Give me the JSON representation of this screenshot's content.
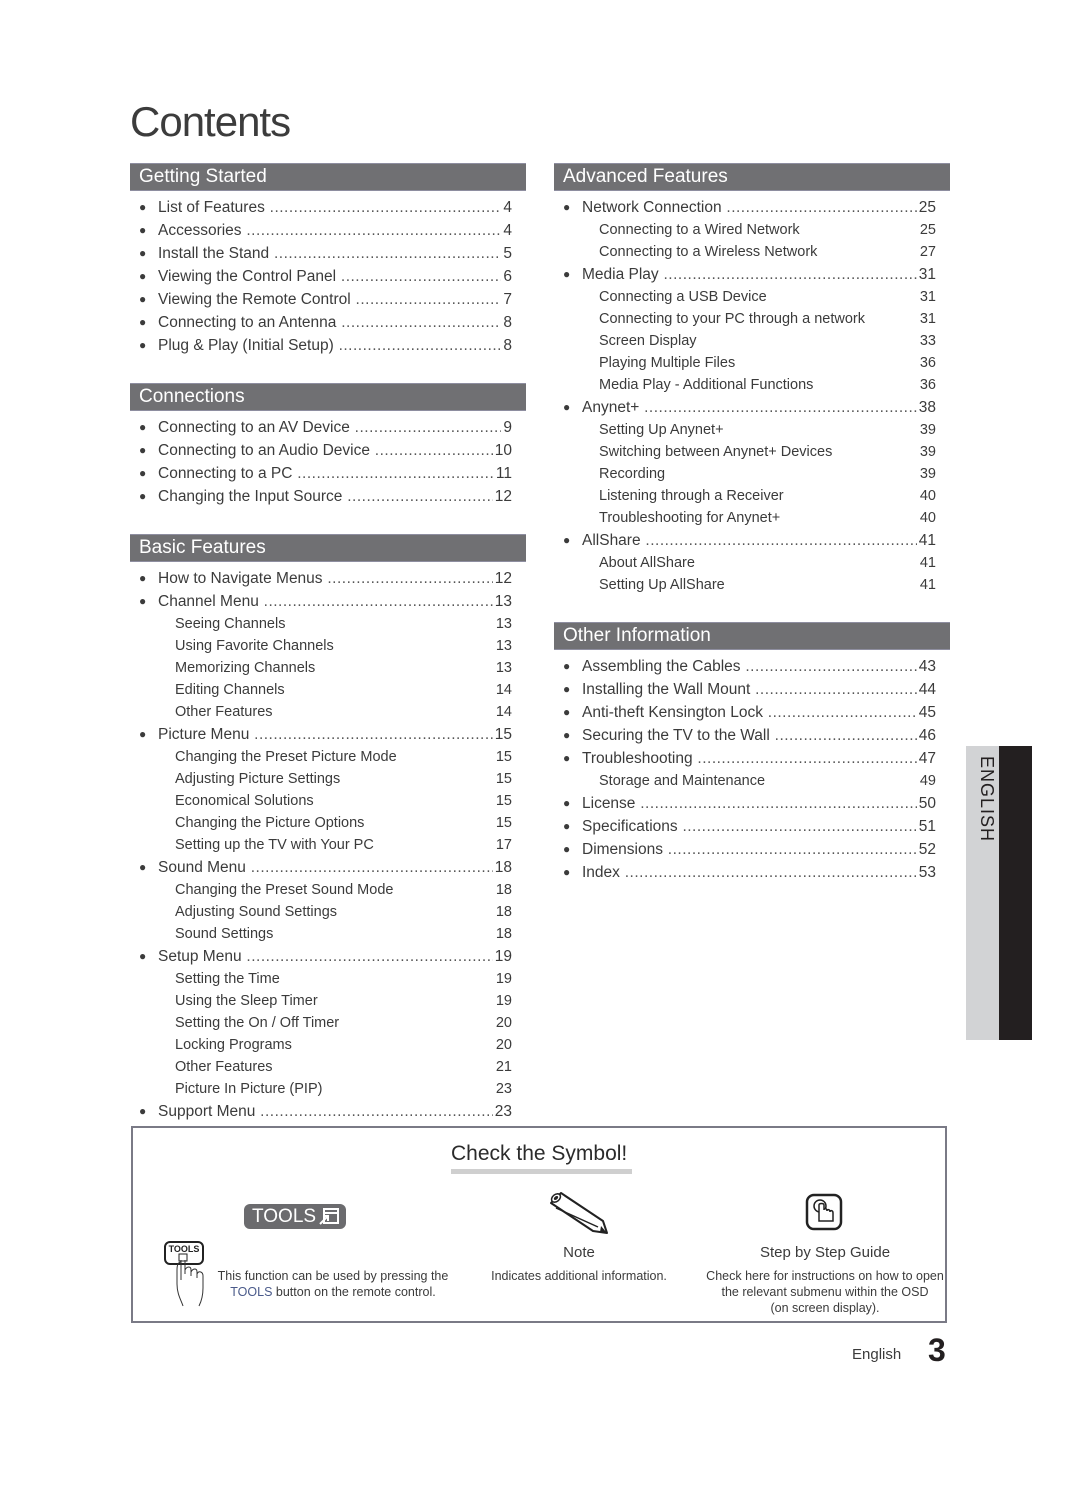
{
  "page_title": "Contents",
  "left_column": [
    {
      "heading": "Getting Started",
      "items": [
        {
          "label": "List of Features",
          "page": "4",
          "level": 1
        },
        {
          "label": "Accessories",
          "page": "4",
          "level": 1
        },
        {
          "label": "Install the Stand",
          "page": "5",
          "level": 1
        },
        {
          "label": "Viewing the Control Panel",
          "page": "6",
          "level": 1
        },
        {
          "label": "Viewing the Remote Control",
          "page": "7",
          "level": 1
        },
        {
          "label": "Connecting to an Antenna",
          "page": "8",
          "level": 1
        },
        {
          "label": "Plug & Play (Initial Setup)",
          "page": "8",
          "level": 1
        }
      ]
    },
    {
      "heading": "Connections",
      "items": [
        {
          "label": "Connecting to an AV Device",
          "page": "9",
          "level": 1
        },
        {
          "label": "Connecting to an Audio Device",
          "page": "10",
          "level": 1
        },
        {
          "label": "Connecting to a PC",
          "page": "11",
          "level": 1
        },
        {
          "label": "Changing the Input Source",
          "page": "12",
          "level": 1
        }
      ]
    },
    {
      "heading": "Basic Features",
      "items": [
        {
          "label": "How to Navigate Menus",
          "page": "12",
          "level": 1
        },
        {
          "label": "Channel Menu",
          "page": "13",
          "level": 1
        },
        {
          "label": "Seeing Channels",
          "page": "13",
          "level": 2
        },
        {
          "label": "Using Favorite Channels",
          "page": "13",
          "level": 2
        },
        {
          "label": "Memorizing Channels",
          "page": "13",
          "level": 2
        },
        {
          "label": "Editing Channels",
          "page": "14",
          "level": 2
        },
        {
          "label": "Other Features",
          "page": "14",
          "level": 2
        },
        {
          "label": "Picture Menu",
          "page": "15",
          "level": 1
        },
        {
          "label": "Changing the Preset Picture Mode",
          "page": "15",
          "level": 2
        },
        {
          "label": "Adjusting Picture Settings",
          "page": "15",
          "level": 2
        },
        {
          "label": "Economical Solutions",
          "page": "15",
          "level": 2
        },
        {
          "label": "Changing the Picture Options",
          "page": "15",
          "level": 2
        },
        {
          "label": "Setting up the TV with Your PC",
          "page": "17",
          "level": 2
        },
        {
          "label": "Sound Menu",
          "page": "18",
          "level": 1
        },
        {
          "label": "Changing the Preset Sound Mode",
          "page": "18",
          "level": 2
        },
        {
          "label": "Adjusting Sound Settings",
          "page": "18",
          "level": 2
        },
        {
          "label": "Sound Settings",
          "page": "18",
          "level": 2
        },
        {
          "label": "Setup Menu",
          "page": "19",
          "level": 1
        },
        {
          "label": "Setting the Time",
          "page": "19",
          "level": 2
        },
        {
          "label": "Using the Sleep Timer",
          "page": "19",
          "level": 2
        },
        {
          "label": "Setting the On / Off Timer",
          "page": "20",
          "level": 2
        },
        {
          "label": "Locking Programs",
          "page": "20",
          "level": 2
        },
        {
          "label": "Other Features",
          "page": "21",
          "level": 2
        },
        {
          "label": "Picture In Picture (PIP)",
          "page": "23",
          "level": 2
        },
        {
          "label": "Support Menu",
          "page": "23",
          "level": 1
        }
      ]
    }
  ],
  "right_column": [
    {
      "heading": "Advanced Features",
      "items": [
        {
          "label": "Network Connection",
          "page": "25",
          "level": 1
        },
        {
          "label": "Connecting to a Wired Network",
          "page": "25",
          "level": 2
        },
        {
          "label": "Connecting to a Wireless Network",
          "page": "27",
          "level": 2
        },
        {
          "label": "Media Play",
          "page": "31",
          "level": 1
        },
        {
          "label": "Connecting a USB Device",
          "page": "31",
          "level": 2
        },
        {
          "label": "Connecting to your PC through a network",
          "page": "31",
          "level": 2
        },
        {
          "label": "Screen Display",
          "page": "33",
          "level": 2
        },
        {
          "label": "Playing Multiple Files",
          "page": "36",
          "level": 2
        },
        {
          "label": "Media Play - Additional Functions",
          "page": "36",
          "level": 2
        },
        {
          "label": "Anynet+",
          "page": "38",
          "level": 1
        },
        {
          "label": "Setting Up Anynet+",
          "page": "39",
          "level": 2
        },
        {
          "label": "Switching between Anynet+ Devices",
          "page": "39",
          "level": 2
        },
        {
          "label": "Recording",
          "page": "39",
          "level": 2
        },
        {
          "label": "Listening through a Receiver",
          "page": "40",
          "level": 2
        },
        {
          "label": "Troubleshooting for Anynet+",
          "page": "40",
          "level": 2
        },
        {
          "label": "AllShare",
          "page": "41",
          "level": 1
        },
        {
          "label": "About AllShare",
          "page": "41",
          "level": 2
        },
        {
          "label": "Setting Up AllShare",
          "page": "41",
          "level": 2
        }
      ]
    },
    {
      "heading": "Other Information",
      "items": [
        {
          "label": "Assembling the Cables",
          "page": "43",
          "level": 1
        },
        {
          "label": "Installing the Wall Mount",
          "page": "44",
          "level": 1
        },
        {
          "label": "Anti-theft Kensington Lock",
          "page": "45",
          "level": 1
        },
        {
          "label": "Securing the TV to the Wall",
          "page": "46",
          "level": 1
        },
        {
          "label": "Troubleshooting",
          "page": "47",
          "level": 1
        },
        {
          "label": "Storage and Maintenance",
          "page": "49",
          "level": 2
        },
        {
          "label": "License",
          "page": "50",
          "level": 1
        },
        {
          "label": "Specifications",
          "page": "51",
          "level": 1
        },
        {
          "label": "Dimensions",
          "page": "52",
          "level": 1
        },
        {
          "label": "Index",
          "page": "53",
          "level": 1
        }
      ]
    }
  ],
  "language_tab": "ENGLISH",
  "symbols": {
    "title": "Check the Symbol!",
    "tools": {
      "badge_label": "TOOLS",
      "icon_label": "TOOLS",
      "desc_line1": "This function can be used by pressing the",
      "desc_line2_highlight": "TOOLS",
      "desc_line2_rest": " button on the remote control."
    },
    "note": {
      "label": "Note",
      "desc": "Indicates additional information."
    },
    "guide": {
      "label": "Step by Step Guide",
      "desc_line1": "Check here for instructions on how to open",
      "desc_line2": "the relevant submenu within the OSD",
      "desc_line3": "(on screen display)."
    }
  },
  "footer": {
    "language": "English",
    "page_number": "3"
  },
  "colors": {
    "section_header_bg": "#707073",
    "tab_light": "#d2d3d5",
    "tab_dark": "#231f20",
    "tools_highlight": "#4a5a8a"
  }
}
